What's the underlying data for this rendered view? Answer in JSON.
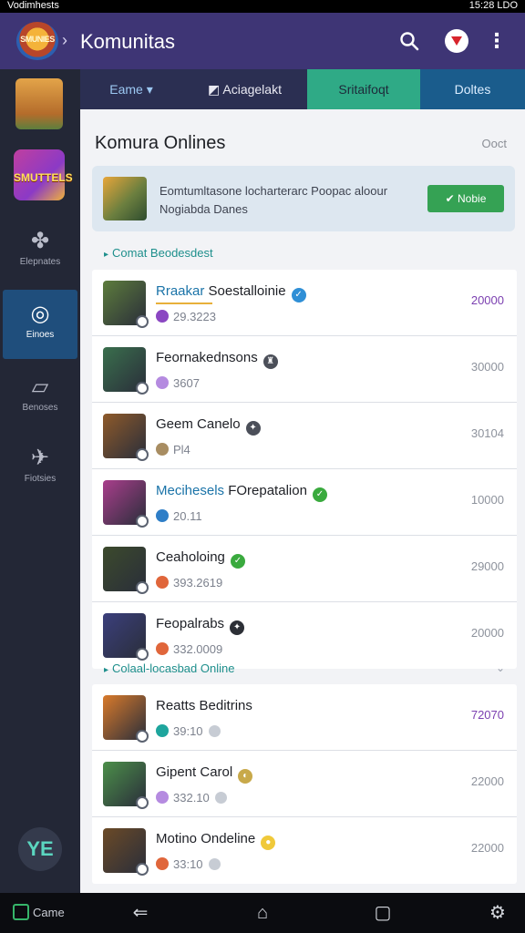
{
  "status_bar": {
    "left_text": "Vodimhests",
    "right_text": "15:28 LDO"
  },
  "app_bar": {
    "logo_text": "SMUNIES",
    "title": "Komunitas"
  },
  "sidebar": {
    "game_label": "SMUTTELS",
    "items": [
      {
        "label": "Elepnates",
        "icon": "puzzle-icon"
      },
      {
        "label": "Einoes",
        "icon": "compass-icon",
        "active": true
      },
      {
        "label": "Benoses",
        "icon": "cards-icon"
      },
      {
        "label": "Fiotsies",
        "icon": "bird-icon"
      }
    ],
    "fab_label": "YE"
  },
  "tabs": [
    {
      "label": "Eame ▾"
    },
    {
      "label": "Aciagelakt"
    },
    {
      "label": "Sritaifoqt",
      "active": true
    },
    {
      "label": "Doltes"
    }
  ],
  "content": {
    "title": "Komura Onlines",
    "action": "Ooct",
    "banner": {
      "text": "Eomtumltasone locharterarc Poopac aloour Nogiabda Danes",
      "button_label": "Nobie"
    },
    "section1": {
      "title": "Comat Beodesdest"
    },
    "section2": {
      "title": "Colaal-locasbad Online"
    },
    "rows1": [
      {
        "name_hl": "Rraakar",
        "name": "Soestalloinie",
        "meta": "29.3223",
        "value": "20000",
        "value_purple": true,
        "thumb_color": "#5d7c3c",
        "badge_color": "#2f8fd6",
        "dot_color": "#8b47c2",
        "badge_glyph": "✓"
      },
      {
        "name_hl": "",
        "name": "Feornakednsons",
        "meta": "3607",
        "value": "30000",
        "value_purple": false,
        "thumb_color": "#3a6f4d",
        "badge_color": "#4b4f59",
        "dot_color": "#b58be0",
        "badge_glyph": "♜"
      },
      {
        "name_hl": "",
        "name": "Geem Canelo",
        "meta": "Pl4",
        "value": "30104",
        "value_purple": false,
        "thumb_color": "#8e5a2a",
        "badge_color": "#4b4f59",
        "dot_color": "#a88d62",
        "badge_glyph": "✦"
      },
      {
        "name_hl": "Mecihesels",
        "name": "FOrepatalion",
        "meta": "20.11",
        "value": "10000",
        "value_purple": false,
        "thumb_color": "#a93e8c",
        "badge_color": "#3aaa3e",
        "dot_color": "#2e7ec7",
        "badge_glyph": "✓"
      },
      {
        "name_hl": "",
        "name": "Ceaholoing",
        "meta": "393.2619",
        "value": "29000",
        "value_purple": false,
        "thumb_color": "#3c4a2c",
        "badge_color": "#3aaa3e",
        "dot_color": "#e0663b",
        "badge_glyph": "✓"
      },
      {
        "name_hl": "",
        "name": "Feopalrabs",
        "meta": "332.0009",
        "value": "20000",
        "value_purple": false,
        "thumb_color": "#3b3f7c",
        "badge_color": "#2c2f36",
        "dot_color": "#e0663b",
        "badge_glyph": "✦"
      }
    ],
    "rows2": [
      {
        "name_hl": "",
        "name": "Reatts Beditrins",
        "meta": "39:10",
        "value": "72070",
        "value_purple": true,
        "thumb_color": "#d97a2b",
        "badge_color": "",
        "dot_color": "#1ea59d",
        "badge_glyph": ""
      },
      {
        "name_hl": "",
        "name": "Gipent Carol",
        "meta": "332.10",
        "value": "22000",
        "value_purple": false,
        "thumb_color": "#4c8f4a",
        "badge_color": "#c8a94a",
        "dot_color": "#b58be0",
        "badge_glyph": "◐"
      },
      {
        "name_hl": "",
        "name": "Motino Ondeline",
        "meta": "33:10",
        "value": "22000",
        "value_purple": false,
        "thumb_color": "#6b4a27",
        "badge_color": "#f0c93a",
        "dot_color": "#e0663b",
        "badge_glyph": "●"
      }
    ]
  },
  "nav_bar": {
    "game_label": "Came"
  }
}
